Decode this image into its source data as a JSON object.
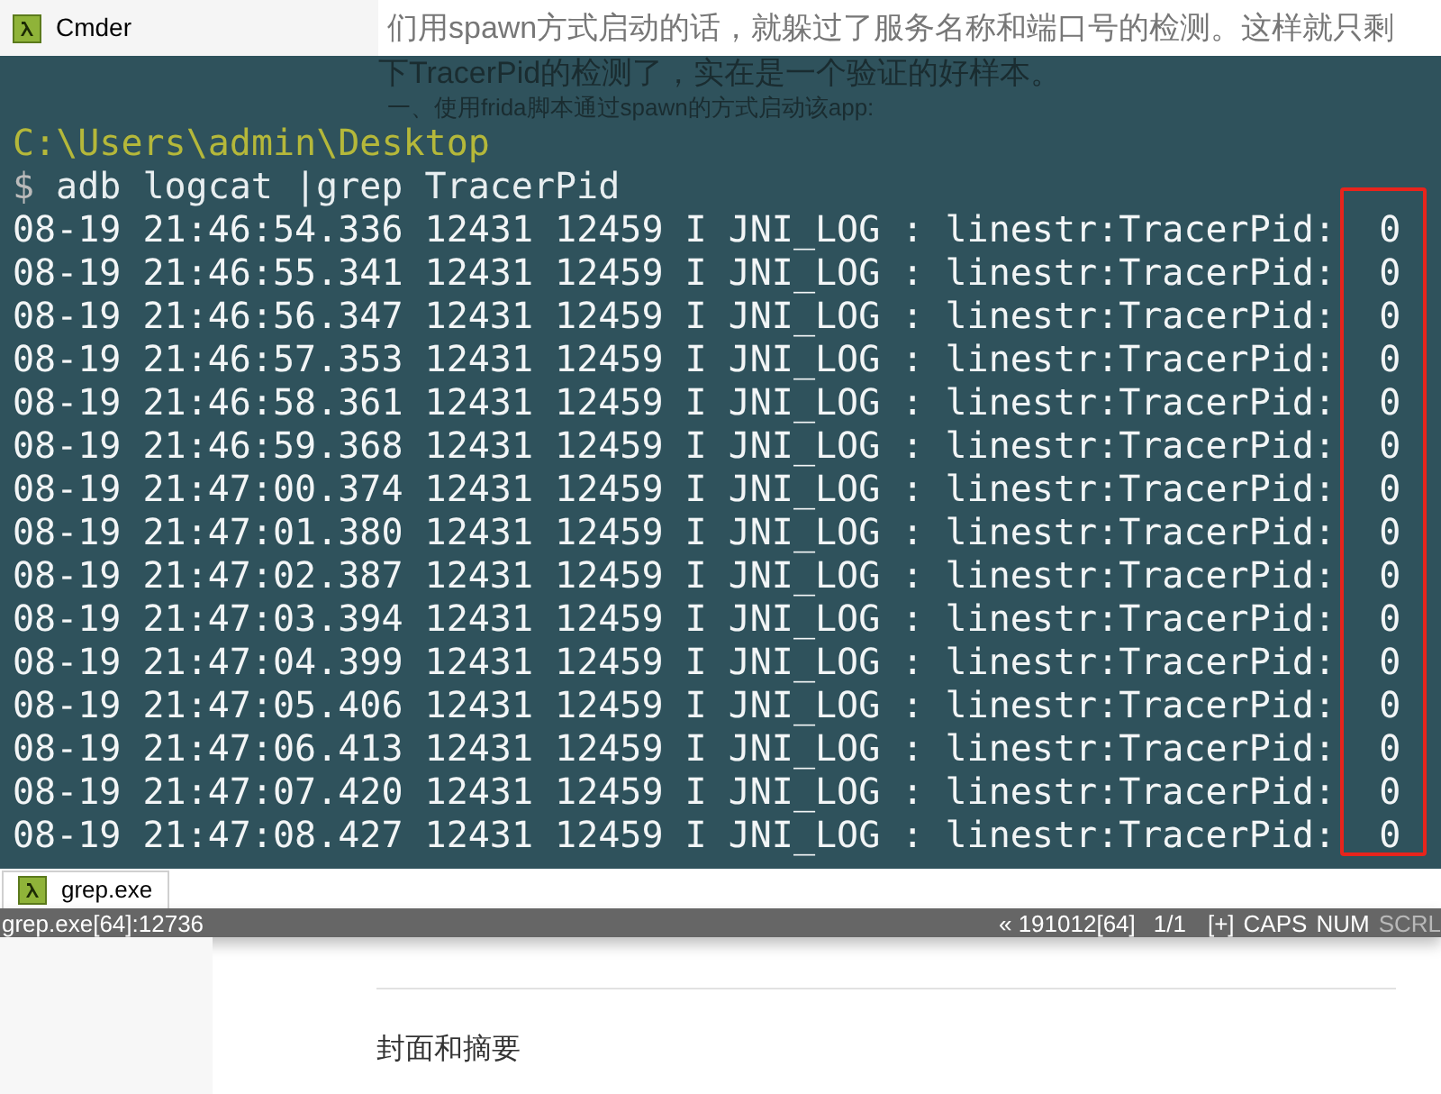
{
  "window": {
    "title": "Cmder"
  },
  "page_text": {
    "line_1": "们用spawn方式启动的话，就躲过了服务名称和端口号的检测。这样就只剩",
    "line_2": "下TracerPid的检测了，实在是一个验证的好样本。",
    "step_1": "一、使用frida脚本通过spawn的方式启动该app:",
    "section": "封面和摘要"
  },
  "terminal": {
    "prompt_path": "C:\\Users\\admin\\Desktop",
    "prompt_symbol": "$",
    "command": "adb logcat |grep TracerPid",
    "lines": [
      "08-19 21:46:54.336 12431 12459 I JNI_LOG : linestr:TracerPid:  0",
      "08-19 21:46:55.341 12431 12459 I JNI_LOG : linestr:TracerPid:  0",
      "08-19 21:46:56.347 12431 12459 I JNI_LOG : linestr:TracerPid:  0",
      "08-19 21:46:57.353 12431 12459 I JNI_LOG : linestr:TracerPid:  0",
      "08-19 21:46:58.361 12431 12459 I JNI_LOG : linestr:TracerPid:  0",
      "08-19 21:46:59.368 12431 12459 I JNI_LOG : linestr:TracerPid:  0",
      "08-19 21:47:00.374 12431 12459 I JNI_LOG : linestr:TracerPid:  0",
      "08-19 21:47:01.380 12431 12459 I JNI_LOG : linestr:TracerPid:  0",
      "08-19 21:47:02.387 12431 12459 I JNI_LOG : linestr:TracerPid:  0",
      "08-19 21:47:03.394 12431 12459 I JNI_LOG : linestr:TracerPid:  0",
      "08-19 21:47:04.399 12431 12459 I JNI_LOG : linestr:TracerPid:  0",
      "08-19 21:47:05.406 12431 12459 I JNI_LOG : linestr:TracerPid:  0",
      "08-19 21:47:06.413 12431 12459 I JNI_LOG : linestr:TracerPid:  0",
      "08-19 21:47:07.420 12431 12459 I JNI_LOG : linestr:TracerPid:  0",
      "08-19 21:47:08.427 12431 12459 I JNI_LOG : linestr:TracerPid:  0"
    ]
  },
  "tabs": [
    {
      "label": "grep.exe",
      "selected": true
    }
  ],
  "status_bar": {
    "process": "grep.exe[64]:12736",
    "build": "« 191012[64]",
    "pages": "1/1",
    "plus": "[+]",
    "indicators": [
      {
        "label": "CAPS",
        "on": true
      },
      {
        "label": "NUM",
        "on": true
      },
      {
        "label": "SCRL",
        "on": false
      }
    ]
  }
}
